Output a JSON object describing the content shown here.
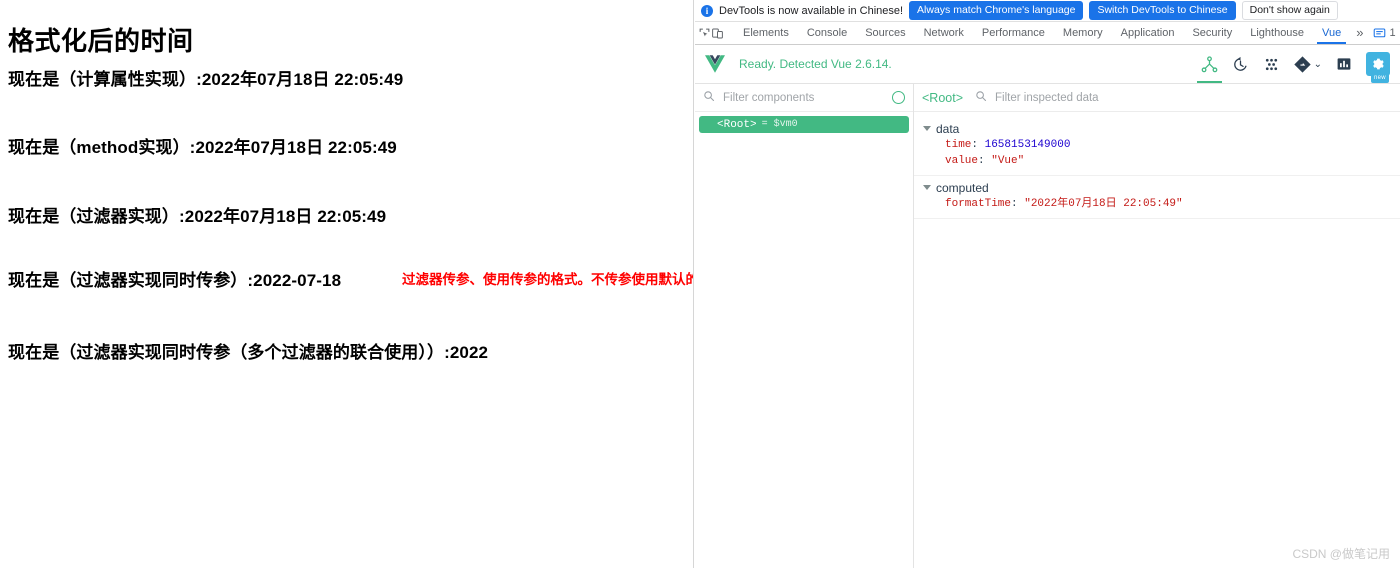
{
  "page": {
    "title": "格式化后的时间",
    "lines": [
      "现在是（计算属性实现）:2022年07月18日 22:05:49",
      "现在是（method实现）:2022年07月18日 22:05:49",
      "现在是（过滤器实现）:2022年07月18日 22:05:49",
      "现在是（过滤器实现同时传参）:2022-07-18",
      "现在是（过滤器实现同时传参（多个过滤器的联合使用））:2022"
    ],
    "annotation": "过滤器传参、使用传参的格式。不传参使用默认的格式",
    "annotation_color": "#ff0000"
  },
  "devtools": {
    "banner": {
      "icon": "info-icon",
      "message": "DevTools is now available in Chinese!",
      "primary_button_1": "Always match Chrome's language",
      "primary_button_2": "Switch DevTools to Chinese",
      "plain_button": "Don't show again",
      "primary_color": "#1a73e8"
    },
    "tabs": [
      {
        "label": "Elements",
        "active": false
      },
      {
        "label": "Console",
        "active": false
      },
      {
        "label": "Sources",
        "active": false
      },
      {
        "label": "Network",
        "active": false
      },
      {
        "label": "Performance",
        "active": false
      },
      {
        "label": "Memory",
        "active": false
      },
      {
        "label": "Application",
        "active": false
      },
      {
        "label": "Security",
        "active": false
      },
      {
        "label": "Lighthouse",
        "active": false
      },
      {
        "label": "Vue",
        "active": true
      }
    ],
    "overflow_label": "»",
    "issues_count": "1",
    "active_tab_color": "#1a73e8"
  },
  "vue": {
    "status": "Ready. Detected Vue 2.6.14.",
    "brand_color": "#42b983",
    "settings_badge": "new",
    "components": {
      "filter_placeholder": "Filter components",
      "filter_value": "",
      "tree": [
        {
          "name": "<Root>",
          "instance": "= $vm0",
          "selected": true
        }
      ]
    },
    "inspector": {
      "root_label": "<Root>",
      "filter_placeholder": "Filter inspected data",
      "filter_value": "",
      "groups": [
        {
          "name": "data",
          "expanded": true,
          "rows": [
            {
              "key": "time",
              "value": "1658153149000",
              "kind": "number"
            },
            {
              "key": "value",
              "value": "\"Vue\"",
              "kind": "string"
            }
          ]
        },
        {
          "name": "computed",
          "expanded": true,
          "rows": [
            {
              "key": "formatTime",
              "value": "\"2022年07月18日 22:05:49\"",
              "kind": "string"
            }
          ]
        }
      ]
    }
  },
  "watermark": "CSDN @做笔记用"
}
